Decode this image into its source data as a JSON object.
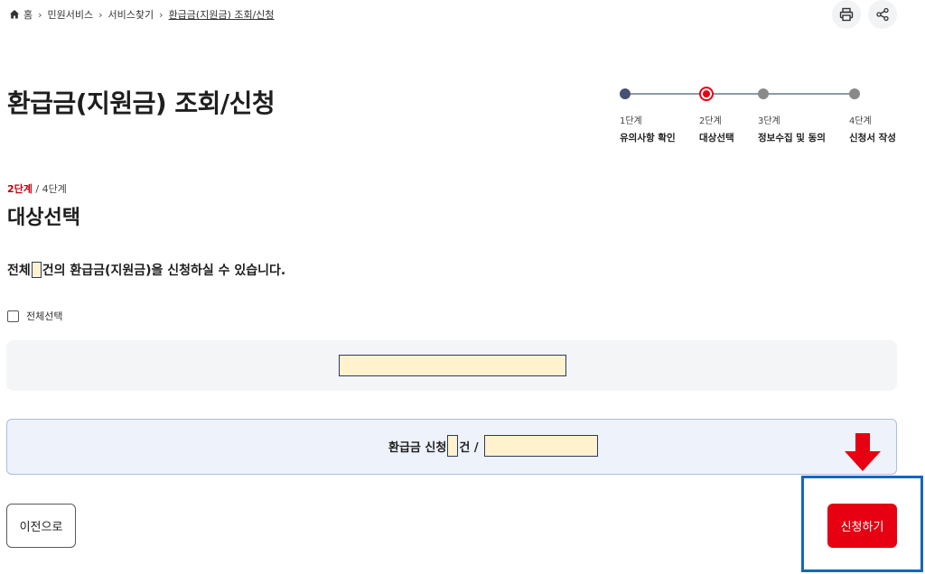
{
  "breadcrumb": {
    "home": "홈",
    "items": [
      "민원서비스",
      "서비스찾기"
    ],
    "current": "환급금(지원금) 조회/신청"
  },
  "toolbar": {
    "print_icon": "print-icon",
    "share_icon": "share-icon"
  },
  "page": {
    "title": "환급금(지원금) 조회/신청"
  },
  "stepper": {
    "steps": [
      {
        "num": "1단계",
        "label": "유의사항 확인",
        "state": "done"
      },
      {
        "num": "2단계",
        "label": "대상선택",
        "state": "active"
      },
      {
        "num": "3단계",
        "label": "정보수집 및 동의",
        "state": "todo"
      },
      {
        "num": "4단계",
        "label": "신청서 작성",
        "state": "todo"
      }
    ]
  },
  "step_indicator": {
    "current": "2단계",
    "total": " / 4단계"
  },
  "section": {
    "title": "대상선택"
  },
  "summary": {
    "prefix": "전체",
    "suffix": "건의 환급금(지원금)을 신청하실 수 있습니다."
  },
  "select_all": {
    "label": "전체선택"
  },
  "apply_summary": {
    "prefix": "환급금 신청",
    "suffix": "건 /"
  },
  "buttons": {
    "prev": "이전으로",
    "submit": "신청하기"
  },
  "colors": {
    "accent": "#e60012",
    "highlight": "#1565c0",
    "field_fill": "#fff2cc",
    "navy": "#2b3a64"
  }
}
